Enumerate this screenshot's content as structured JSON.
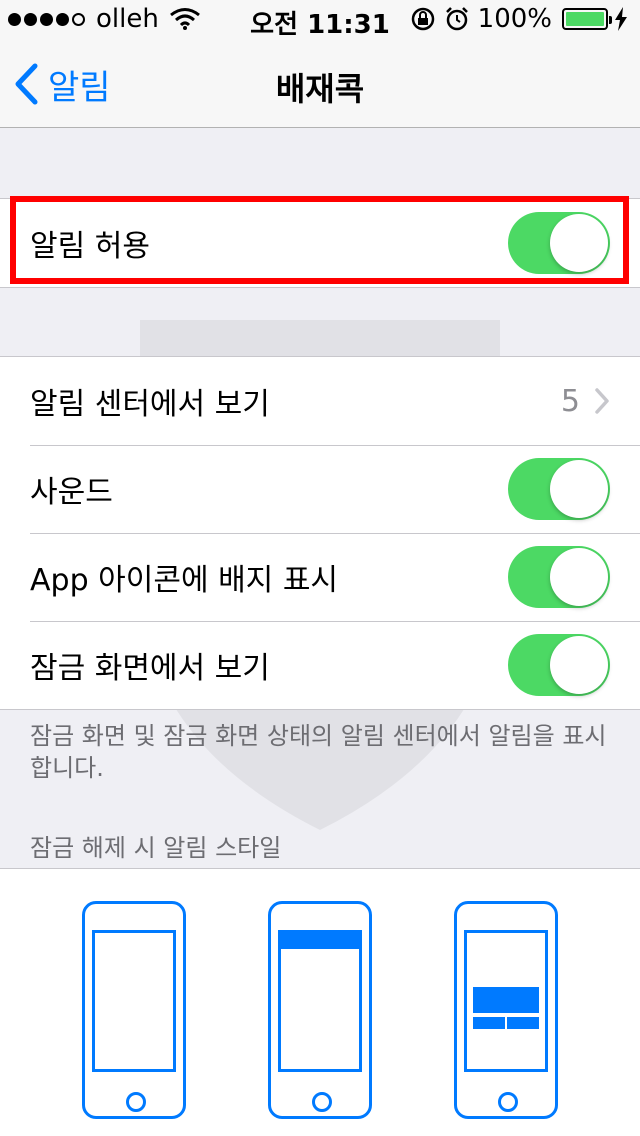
{
  "status_bar": {
    "carrier": "olleh",
    "time": "오전 11:31",
    "battery": "100%"
  },
  "nav": {
    "back_label": "알림",
    "title": "배재콕"
  },
  "allow": {
    "label": "알림 허용",
    "on": true
  },
  "settings": {
    "notification_center": {
      "label": "알림 센터에서 보기",
      "value": "5"
    },
    "sound": {
      "label": "사운드",
      "on": true
    },
    "badge": {
      "label": "App 아이콘에 배지 표시",
      "on": true
    },
    "lock_screen": {
      "label": "잠금 화면에서 보기",
      "on": true
    }
  },
  "footnote": "잠금 화면 및 잠금 화면 상태의 알림 센터에서 알림을 표시합니다.",
  "alert_style_header": "잠금 해제 시 알림 스타일",
  "alert_styles": [
    "none-icon",
    "banner-icon",
    "alert-icon"
  ],
  "colors": {
    "accent": "#007aff",
    "toggle_on": "#4cd964",
    "highlight": "#ff0000"
  }
}
